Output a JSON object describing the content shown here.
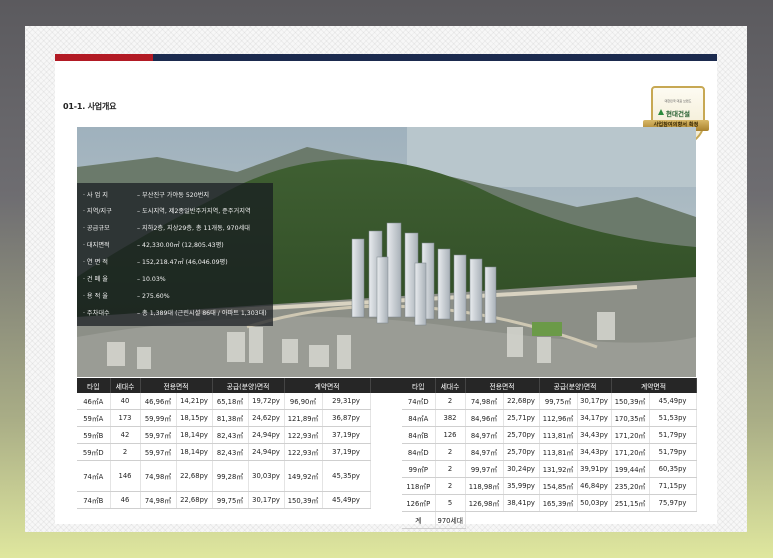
{
  "section_title": "01-1. 사업개요",
  "badge": {
    "slogan": "대한민국 대표 브랜드",
    "brand": "현대건설",
    "ribbon": "사업참여의향서 확정"
  },
  "info": [
    {
      "k": "· 사  업  지",
      "v": "– 부산진구 가야동 520번지"
    },
    {
      "k": "· 지역/지구",
      "v": "– 도시지역, 제2종일반주거지역, 준주거지역"
    },
    {
      "k": "· 공급규모",
      "v": "– 지하2층, 지상29층, 총 11개동, 970세대"
    },
    {
      "k": "· 대지면적",
      "v": "– 42,330.00㎡ (12,805.43평)"
    },
    {
      "k": "· 연  면  적",
      "v": "– 152,218.47㎡ (46,046.09평)"
    },
    {
      "k": "· 건  폐  율",
      "v": "– 10.03%"
    },
    {
      "k": "· 용  적  율",
      "v": "– 275.60%"
    },
    {
      "k": "· 주차대수",
      "v": "– 총 1,389대 (근린시설 86대 / 아파트 1,303대)"
    }
  ],
  "table_headers": [
    "타입",
    "세대수",
    "전용면적",
    "공급(분양)면적",
    "계약면적"
  ],
  "left_rows": [
    [
      "46㎡A",
      "40",
      "46,96㎡",
      "14,21py",
      "65,18㎡",
      "19,72py",
      "96,90㎡",
      "29,31py"
    ],
    [
      "59㎡A",
      "173",
      "59,99㎡",
      "18,15py",
      "81,38㎡",
      "24,62py",
      "121,89㎡",
      "36,87py"
    ],
    [
      "59㎡B",
      "42",
      "59,97㎡",
      "18,14py",
      "82,43㎡",
      "24,94py",
      "122,93㎡",
      "37,19py"
    ],
    [
      "59㎡D",
      "2",
      "59,97㎡",
      "18,14py",
      "82,43㎡",
      "24,94py",
      "122,93㎡",
      "37,19py"
    ],
    [
      "74㎡A",
      "146",
      "74,98㎡",
      "22,68py",
      "99,28㎡",
      "30,03py",
      "149,92㎡",
      "45,35py"
    ],
    [
      "74㎡B",
      "46",
      "74,98㎡",
      "22,68py",
      "99,75㎡",
      "30,17py",
      "150,39㎡",
      "45,49py"
    ]
  ],
  "right_rows": [
    [
      "74㎡D",
      "2",
      "74,98㎡",
      "22,68py",
      "99,75㎡",
      "30,17py",
      "150,39㎡",
      "45,49py"
    ],
    [
      "84㎡A",
      "382",
      "84,96㎡",
      "25,71py",
      "112,96㎡",
      "34,17py",
      "170,35㎡",
      "51,53py"
    ],
    [
      "84㎡B",
      "126",
      "84,97㎡",
      "25,70py",
      "113,81㎡",
      "34,43py",
      "171,20㎡",
      "51,79py"
    ],
    [
      "84㎡D",
      "2",
      "84,97㎡",
      "25,70py",
      "113,81㎡",
      "34,43py",
      "171,20㎡",
      "51,79py"
    ],
    [
      "99㎡P",
      "2",
      "99,97㎡",
      "30,24py",
      "131,92㎡",
      "39,91py",
      "199,44㎡",
      "60,35py"
    ],
    [
      "118㎡P",
      "2",
      "118,98㎡",
      "35,99py",
      "154,85㎡",
      "46,84py",
      "235,20㎡",
      "71,15py"
    ],
    [
      "126㎡P",
      "5",
      "126,98㎡",
      "38,41py",
      "165,39㎡",
      "50,03py",
      "251,15㎡",
      "75,97py"
    ]
  ],
  "total": {
    "label": "계",
    "value": "970세대"
  }
}
